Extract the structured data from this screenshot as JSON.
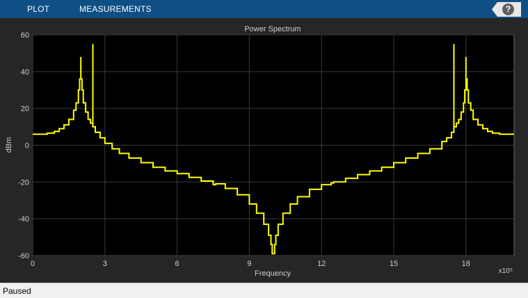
{
  "toolstrip": {
    "tabs": [
      {
        "label": "PLOT"
      },
      {
        "label": "MEASUREMENTS"
      }
    ],
    "help_label": "?"
  },
  "status": {
    "text": "Paused"
  },
  "colors": {
    "toolstrip_bg": "#0f4f86",
    "figure_bg": "#262626",
    "axes_bg": "#000000",
    "trace": "#ffff00",
    "grid": "#3a3a3a"
  },
  "chart_data": {
    "type": "line",
    "title": "Power Spectrum",
    "xlabel": "Frequency",
    "ylabel": "dBm",
    "x_exponent_label": "x10⁵",
    "xlim": [
      0,
      20
    ],
    "ylim": [
      -60,
      60
    ],
    "x_ticks": [
      0,
      3,
      6,
      9,
      12,
      15,
      18
    ],
    "y_ticks": [
      60,
      40,
      20,
      0,
      -20,
      -40,
      -60
    ],
    "grid": true,
    "series": [
      {
        "x": [
          0,
          0.3,
          0.6,
          0.9,
          1.1,
          1.3,
          1.5,
          1.7,
          1.8,
          1.9,
          1.95,
          2.0,
          2.0,
          2.05,
          2.1,
          2.2,
          2.3,
          2.4,
          2.5,
          2.5,
          2.5,
          2.6,
          2.8,
          3.0,
          3.3,
          3.6,
          4.0,
          4.5,
          5.0,
          5.5,
          6.0,
          6.5,
          7.0,
          7.5,
          7.6,
          8.0,
          8.5,
          9.0,
          9.3,
          9.6,
          9.8,
          9.9,
          9.95,
          10.0,
          10.05,
          10.1,
          10.2,
          10.4,
          10.7,
          11.0,
          11.5,
          12.0,
          12.4,
          12.5,
          13.0,
          13.5,
          14.0,
          14.5,
          15.0,
          15.5,
          16.0,
          16.5,
          17.0,
          17.2,
          17.4,
          17.5,
          17.5,
          17.5,
          17.6,
          17.7,
          17.8,
          17.9,
          17.95,
          18.0,
          18.0,
          18.05,
          18.1,
          18.2,
          18.3,
          18.5,
          18.7,
          18.9,
          19.1,
          19.4,
          19.7,
          20.0
        ],
        "y": [
          6,
          6,
          6.5,
          7.5,
          9,
          11,
          14,
          19,
          23,
          30,
          36,
          48,
          36,
          30,
          23,
          18,
          14,
          12,
          10,
          55,
          10,
          7,
          4,
          1,
          -2,
          -4.5,
          -7,
          -9.5,
          -12,
          -14,
          -15.5,
          -17.5,
          -19.5,
          -21.5,
          -21,
          -23.5,
          -27,
          -32,
          -37,
          -43,
          -49,
          -54,
          -59,
          -59,
          -54,
          -49,
          -43,
          -37,
          -32,
          -28,
          -24,
          -21.5,
          -20.5,
          -20,
          -18,
          -16,
          -14,
          -12,
          -9.5,
          -7,
          -4.5,
          -2,
          2,
          4,
          7,
          10,
          55,
          10,
          12,
          14,
          18,
          23,
          30,
          48,
          36,
          30,
          23,
          19,
          14,
          11,
          9,
          7.5,
          6.5,
          6,
          6,
          6
        ]
      }
    ]
  }
}
